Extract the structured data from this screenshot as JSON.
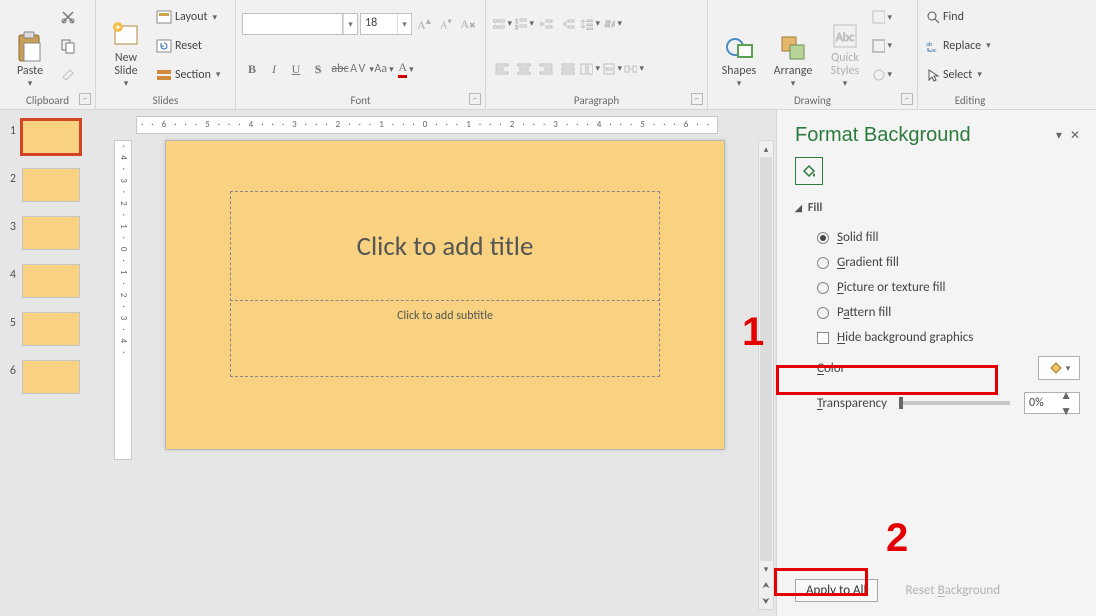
{
  "ribbon": {
    "clipboard": {
      "label": "Clipboard",
      "paste": "Paste"
    },
    "slides": {
      "label": "Slides",
      "new_slide": "New\nSlide",
      "layout": "Layout",
      "reset": "Reset",
      "section": "Section"
    },
    "font": {
      "label": "Font",
      "size": "18"
    },
    "paragraph": {
      "label": "Paragraph"
    },
    "drawing": {
      "label": "Drawing",
      "shapes": "Shapes",
      "arrange": "Arrange",
      "quick_styles": "Quick\nStyles"
    },
    "editing": {
      "label": "Editing",
      "find": "Find",
      "replace": "Replace",
      "select": "Select"
    }
  },
  "thumbs": {
    "count": 6,
    "selected": 1
  },
  "ruler": {
    "h": "· · 6 · · · 5 · · · 4 · · · 3 · · · 2 · · · 1 · · · 0 · · · 1 · · · 2 · · · 3 · · · 4 · · · 5 · · · 6 · ·",
    "v": "· 4 · 3 · 2 · 1 · 0 · 1 · 2 · 3 · 4 ·"
  },
  "slide": {
    "title_placeholder": "Click to add title",
    "subtitle_placeholder": "Click to add subtitle"
  },
  "pane": {
    "title": "Format Background",
    "section": "Fill",
    "opts": {
      "solid": "Solid fill",
      "gradient": "Gradient fill",
      "picture": "Picture or texture fill",
      "pattern": "Pattern fill",
      "hide_bg": "Hide background graphics"
    },
    "color_label": "Color",
    "transparency_label": "Transparency",
    "transparency_value": "0%",
    "apply_all": "Apply to All",
    "reset_bg": "Reset Background"
  },
  "annotations": {
    "one": "1",
    "two": "2"
  }
}
